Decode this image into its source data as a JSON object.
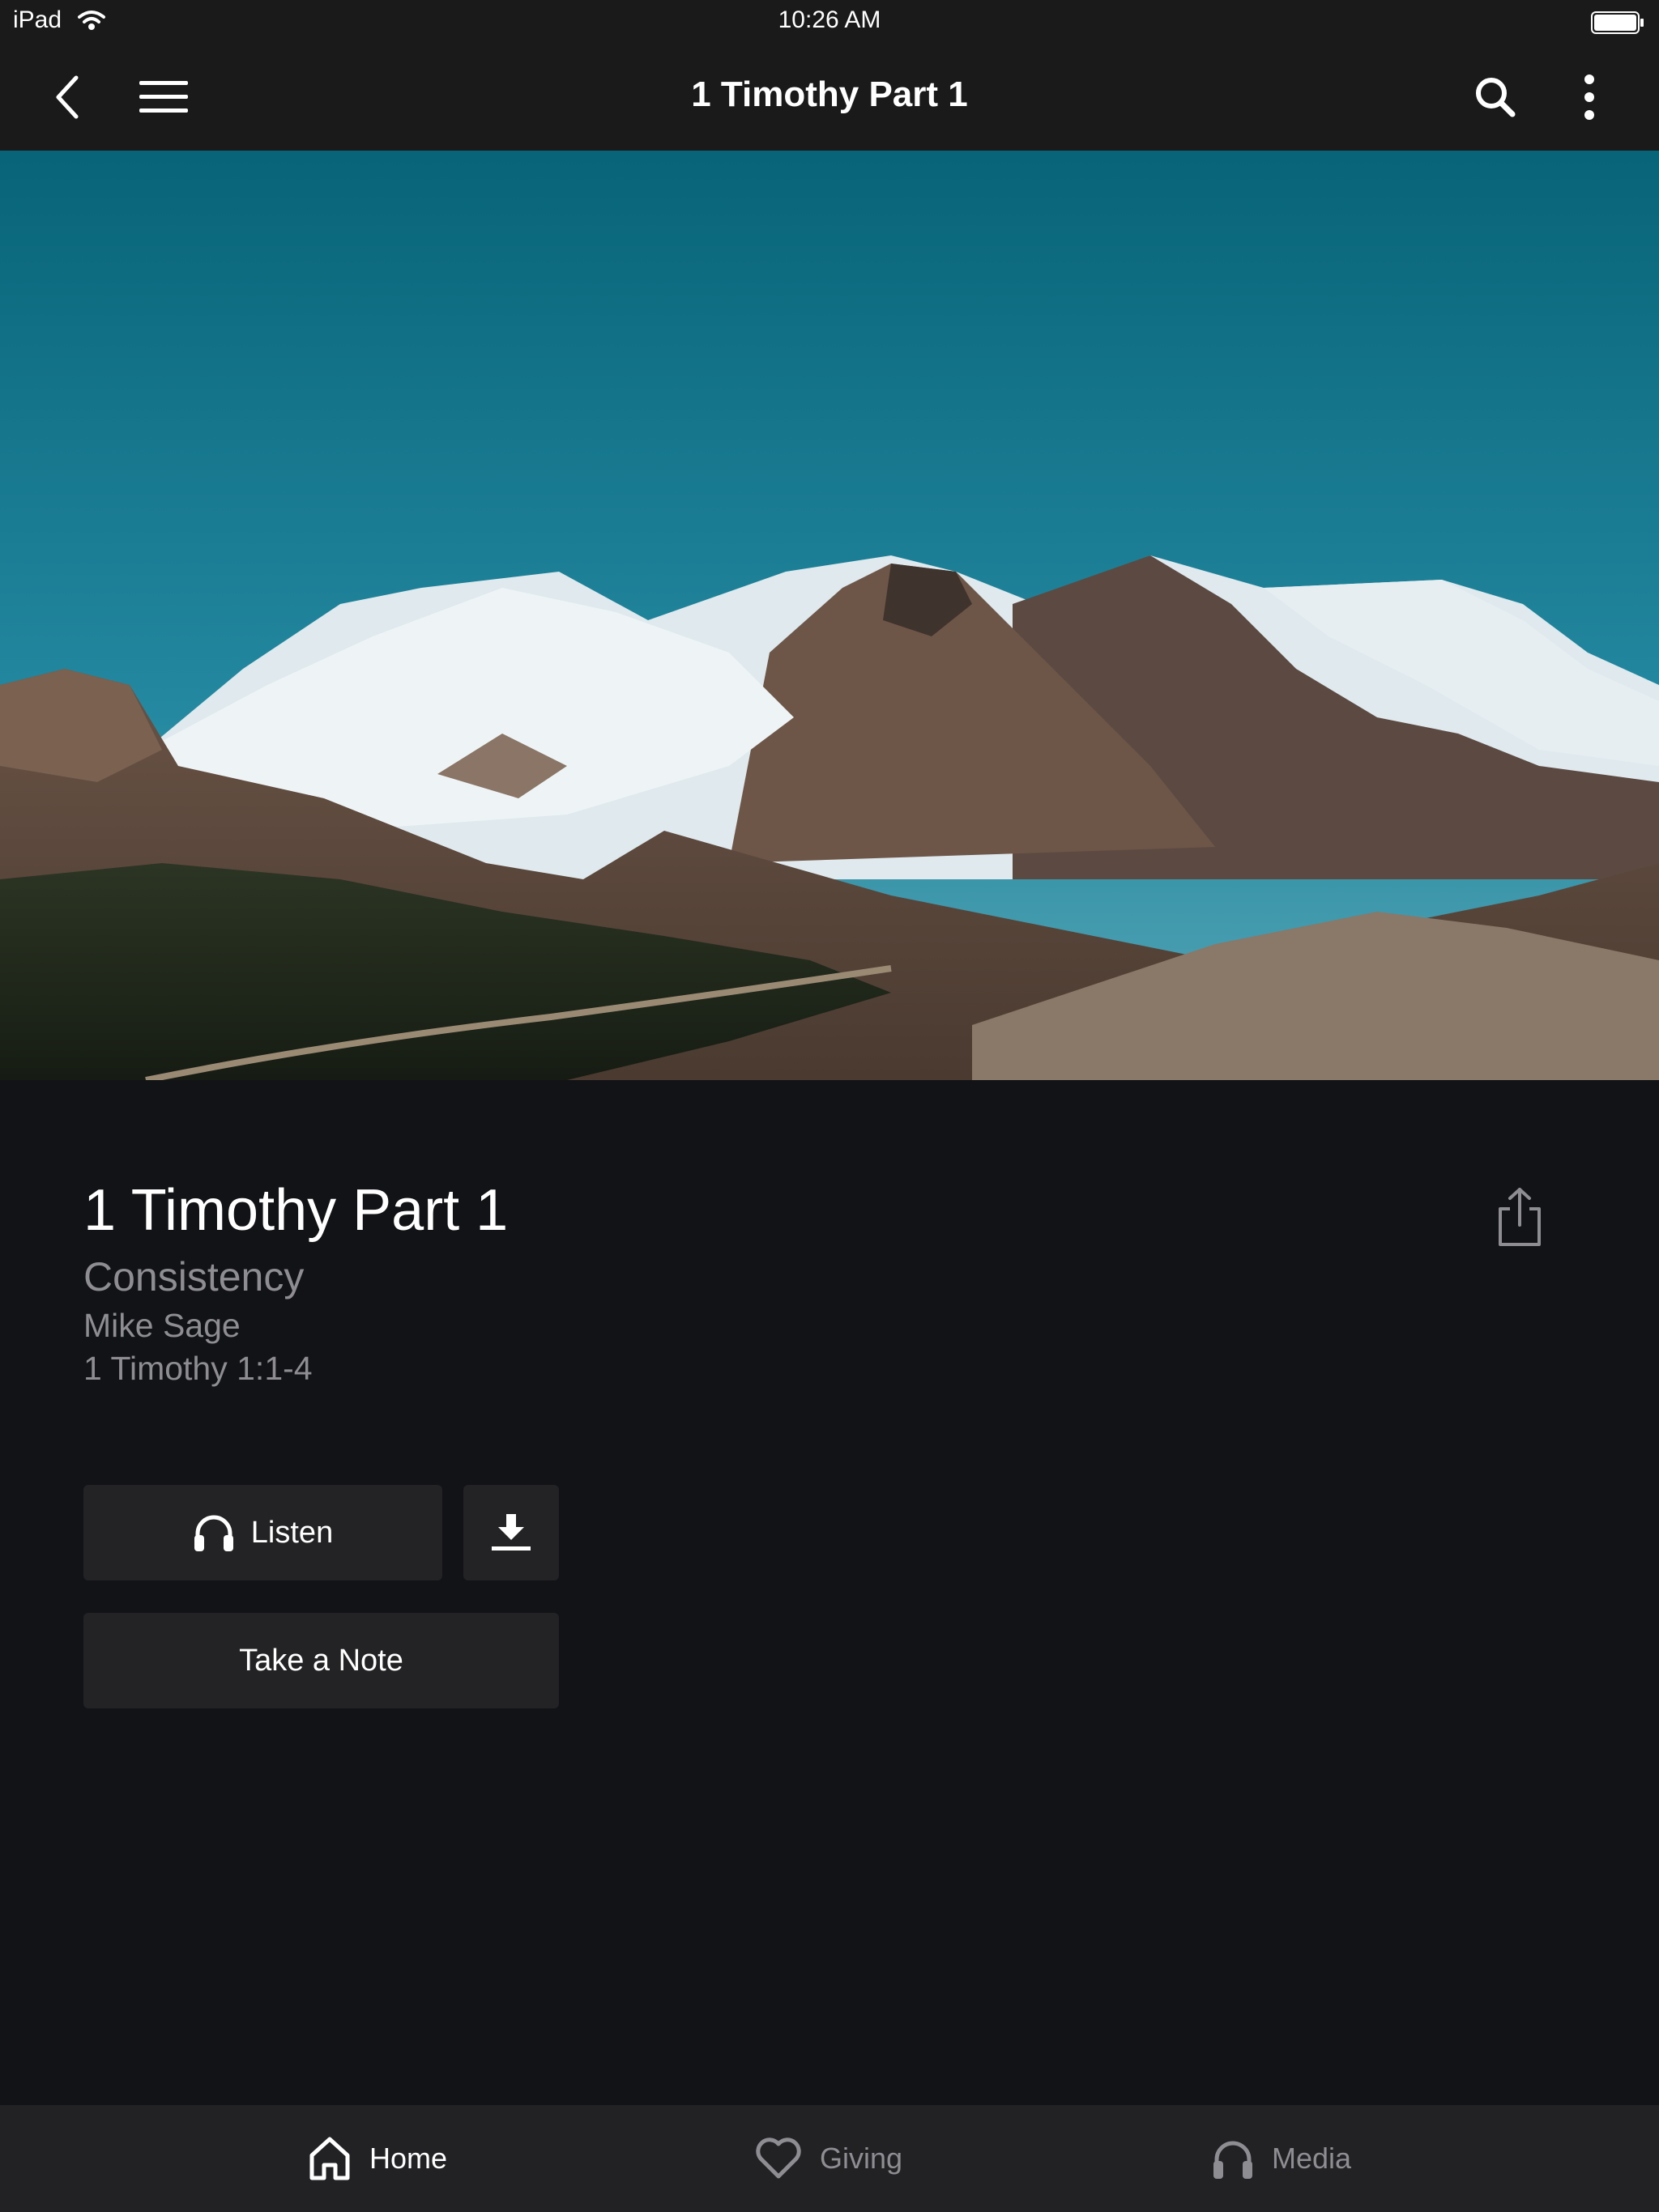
{
  "status_bar": {
    "device": "iPad",
    "time": "10:26 AM"
  },
  "nav": {
    "title": "1 Timothy Part 1"
  },
  "sermon": {
    "title": "1 Timothy Part 1",
    "series": "Consistency",
    "speaker": "Mike Sage",
    "scripture": "1 Timothy 1:1-4"
  },
  "actions": {
    "listen_label": "Listen",
    "note_label": "Take a Note"
  },
  "tabs": [
    {
      "label": "Home",
      "icon": "home-icon",
      "active": true
    },
    {
      "label": "Giving",
      "icon": "heart-icon",
      "active": false
    },
    {
      "label": "Media",
      "icon": "headphones-icon",
      "active": false
    }
  ],
  "colors": {
    "background": "#121316",
    "bar": "#1a1a1a",
    "button": "#232325",
    "secondary_text": "#8d8d92",
    "sky": "#1f7f93"
  }
}
